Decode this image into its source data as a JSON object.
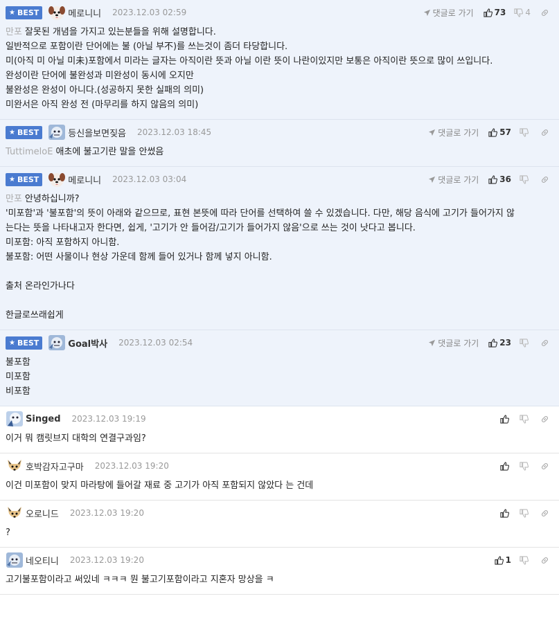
{
  "labels": {
    "best": "BEST",
    "reply_link": "댓글로 가기"
  },
  "colors": {
    "accent": "#4a7bd0",
    "best_bg": "#eef3fb"
  },
  "comments": [
    {
      "best": true,
      "nick": "메로니니",
      "nick_bold": false,
      "avatar": "dog",
      "date": "2023.12.03 02:59",
      "likes": "73",
      "dislikes": "4",
      "mention": "만포",
      "lines": [
        "잘못된 개념을 가지고 있는분들을 위해 설명합니다.",
        "일반적으로 포함이란 단어에는 불 (아닐 부不)를 쓰는것이 좀더 타당합니다.",
        "미(아직 미 아닐 미未)포함에서 미라는 글자는 아직이란 뜻과 아닐 이란 뜻이 나란이있지만 보통은 아직이란 뜻으로 많이 쓰입니다.",
        "완성이란 단어에 불완성과 미완성이 동시에 오지만",
        "불완성은 완성이 아니다.(성공하지 못한 실패의 의미)",
        "미완서은 아직 완성 전 (마무리를 하지 않음의 의미)"
      ]
    },
    {
      "best": true,
      "nick": "등신을보면짖음",
      "nick_bold": false,
      "avatar": "blue",
      "date": "2023.12.03 18:45",
      "likes": "57",
      "dislikes": "",
      "mention": "TuttimeloE",
      "lines": [
        "애초에 불고기란 말을 안썼음"
      ]
    },
    {
      "best": true,
      "nick": "메로니니",
      "nick_bold": false,
      "avatar": "dog",
      "date": "2023.12.03 03:04",
      "likes": "36",
      "dislikes": "",
      "mention": "만포",
      "lines": [
        "안녕하십니까?",
        "'미포함'과 '불포함'의 뜻이 아래와 같으므로, 표현 본뜻에 따라 단어를 선택하여 쓸 수 있겠습니다. 다만, 해당 음식에 고기가 들어가지 않",
        "는다는 뜻을 나타내고자 한다면, 쉽게, '고기가 안 들어감/고기가 들어가지 않음'으로 쓰는 것이 낫다고 봅니다.",
        "미포함: 아직 포함하지 아니함.",
        "불포함: 어떤 사물이나 현상 가운데 함께 들어 있거나 함께 넣지 아니함.",
        "",
        "출처 온라인가나다",
        "",
        "한글로쓰래쉽게"
      ]
    },
    {
      "best": true,
      "nick": "Goal박사",
      "nick_bold": true,
      "avatar": "blue",
      "date": "2023.12.03 02:54",
      "likes": "23",
      "dislikes": "",
      "mention": "",
      "lines": [
        "불포함",
        "미포함",
        "비포함"
      ]
    },
    {
      "best": false,
      "nick": "Singed",
      "nick_bold": true,
      "avatar": "blue2",
      "date": "2023.12.03 19:19",
      "likes": "",
      "dislikes": "",
      "mention": "",
      "lines": [
        "이거 뭐 캠릿브지 대학의 연결구과임?"
      ]
    },
    {
      "best": false,
      "nick": "호박감자고구마",
      "nick_bold": false,
      "avatar": "fox",
      "date": "2023.12.03 19:20",
      "likes": "",
      "dislikes": "",
      "mention": "",
      "lines": [
        "이건 미포함이 맞지 마라탕에 들어갈 재료 중 고기가 아직 포함되지 않았다 는 건데"
      ]
    },
    {
      "best": false,
      "nick": "오로니드",
      "nick_bold": false,
      "avatar": "fox",
      "date": "2023.12.03 19:20",
      "likes": "",
      "dislikes": "",
      "mention": "",
      "lines": [
        "?"
      ]
    },
    {
      "best": false,
      "nick": "네오티니",
      "nick_bold": false,
      "avatar": "blue",
      "date": "2023.12.03 19:20",
      "likes": "1",
      "dislikes": "",
      "mention": "",
      "lines": [
        "고기불포함이라고 써있네 ㅋㅋㅋ 뭔 불고기포함이라고 지혼자 망상을 ㅋ"
      ]
    }
  ]
}
